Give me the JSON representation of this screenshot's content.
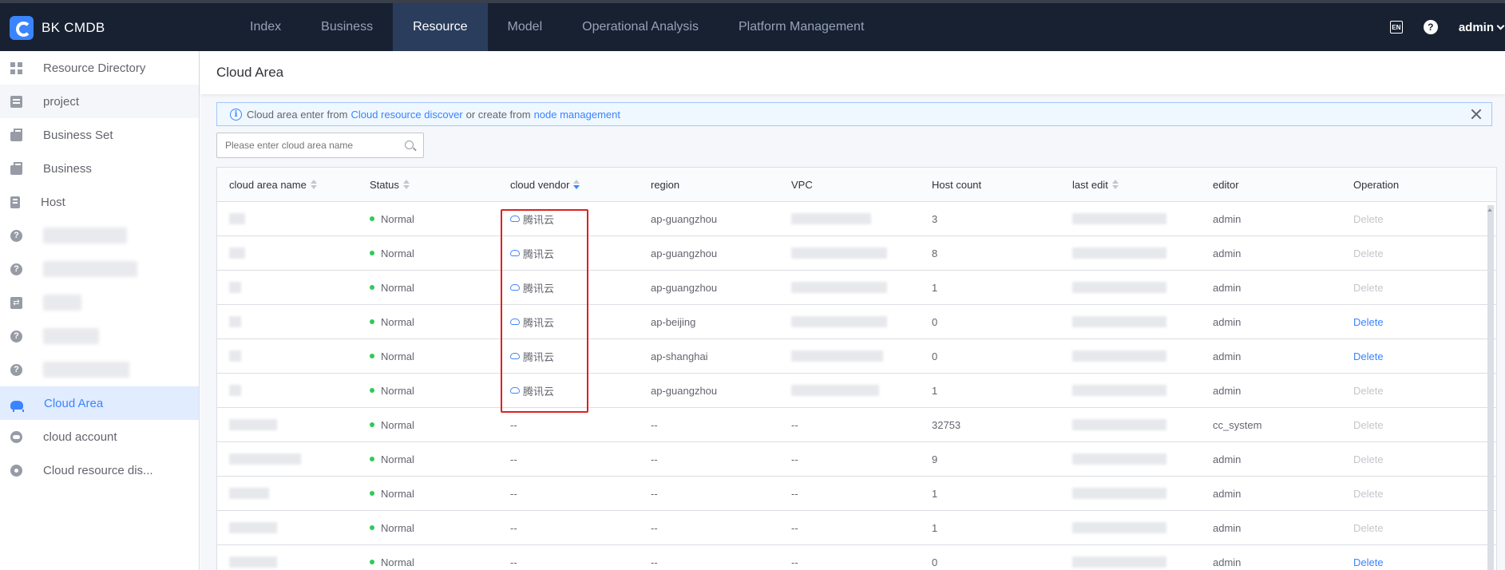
{
  "app": {
    "title": "BK CMDB"
  },
  "nav": {
    "items": [
      {
        "label": "Index"
      },
      {
        "label": "Business"
      },
      {
        "label": "Resource"
      },
      {
        "label": "Model"
      },
      {
        "label": "Operational Analysis"
      },
      {
        "label": "Platform Management"
      }
    ],
    "active": "Resource"
  },
  "topbar": {
    "user": "admin",
    "lang_icon": "EN",
    "help_icon": "?"
  },
  "sidebar": {
    "items": [
      {
        "label": "Resource Directory",
        "icon": "grid-icon"
      },
      {
        "label": "project",
        "icon": "doc-icon"
      },
      {
        "label": "Business Set",
        "icon": "bag-icon"
      },
      {
        "label": "Business",
        "icon": "bag-icon"
      },
      {
        "label": "Host",
        "icon": "host-icon"
      },
      {
        "label": "",
        "icon": "question-icon"
      },
      {
        "label": "",
        "icon": "question-icon"
      },
      {
        "label": "",
        "icon": "swap-icon"
      },
      {
        "label": "",
        "icon": "question-icon"
      },
      {
        "label": "",
        "icon": "question-icon"
      },
      {
        "label": "Cloud Area",
        "icon": "cloud-area-icon"
      },
      {
        "label": "cloud account",
        "icon": "cloud-account-icon"
      },
      {
        "label": "Cloud resource dis...",
        "icon": "discover-icon"
      }
    ],
    "active": "Cloud Area"
  },
  "page": {
    "title": "Cloud Area",
    "notice": {
      "prefix": "Cloud area enter from",
      "link1": "Cloud resource discover",
      "middle": "or create from",
      "link2": "node management"
    },
    "search_placeholder": "Please enter cloud area name"
  },
  "table": {
    "columns": [
      "cloud area name",
      "Status",
      "cloud vendor",
      "region",
      "VPC",
      "Host count",
      "last edit",
      "editor",
      "Operation"
    ],
    "rows": [
      {
        "name": "",
        "status": "Normal",
        "vendor": "腾讯云",
        "region": "ap-guangzhou",
        "vpc": "",
        "host_count": "3",
        "last_edit": "",
        "editor": "admin",
        "operation": "Delete",
        "op_enabled": false
      },
      {
        "name": "",
        "status": "Normal",
        "vendor": "腾讯云",
        "region": "ap-guangzhou",
        "vpc": "",
        "host_count": "8",
        "last_edit": "",
        "editor": "admin",
        "operation": "Delete",
        "op_enabled": false
      },
      {
        "name": "",
        "status": "Normal",
        "vendor": "腾讯云",
        "region": "ap-guangzhou",
        "vpc": "",
        "host_count": "1",
        "last_edit": "",
        "editor": "admin",
        "operation": "Delete",
        "op_enabled": false
      },
      {
        "name": "",
        "status": "Normal",
        "vendor": "腾讯云",
        "region": "ap-beijing",
        "vpc": "",
        "host_count": "0",
        "last_edit": "",
        "editor": "admin",
        "operation": "Delete",
        "op_enabled": true
      },
      {
        "name": "",
        "status": "Normal",
        "vendor": "腾讯云",
        "region": "ap-shanghai",
        "vpc": "",
        "host_count": "0",
        "last_edit": "",
        "editor": "admin",
        "operation": "Delete",
        "op_enabled": true
      },
      {
        "name": "",
        "status": "Normal",
        "vendor": "腾讯云",
        "region": "ap-guangzhou",
        "vpc": "",
        "host_count": "1",
        "last_edit": "",
        "editor": "admin",
        "operation": "Delete",
        "op_enabled": false
      },
      {
        "name": "",
        "status": "Normal",
        "vendor": "--",
        "region": "--",
        "vpc": "--",
        "host_count": "32753",
        "last_edit": "",
        "editor": "cc_system",
        "operation": "Delete",
        "op_enabled": false
      },
      {
        "name": "",
        "status": "Normal",
        "vendor": "--",
        "region": "--",
        "vpc": "--",
        "host_count": "9",
        "last_edit": "",
        "editor": "admin",
        "operation": "Delete",
        "op_enabled": false
      },
      {
        "name": "",
        "status": "Normal",
        "vendor": "--",
        "region": "--",
        "vpc": "--",
        "host_count": "1",
        "last_edit": "",
        "editor": "admin",
        "operation": "Delete",
        "op_enabled": false
      },
      {
        "name": "",
        "status": "Normal",
        "vendor": "--",
        "region": "--",
        "vpc": "--",
        "host_count": "1",
        "last_edit": "",
        "editor": "admin",
        "operation": "Delete",
        "op_enabled": false
      },
      {
        "name": "",
        "status": "Normal",
        "vendor": "--",
        "region": "--",
        "vpc": "--",
        "host_count": "0",
        "last_edit": "",
        "editor": "admin",
        "operation": "Delete",
        "op_enabled": true
      }
    ]
  },
  "colors": {
    "accent": "#3a84ff",
    "topbar": "#182132",
    "status_normal": "#2dcb56",
    "highlight": "#e02020"
  }
}
